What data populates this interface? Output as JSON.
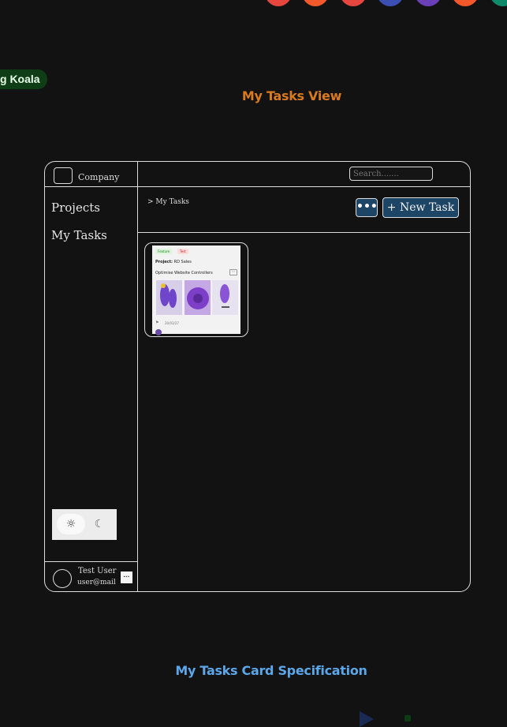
{
  "palette": {
    "colors": [
      "#e5473f",
      "#f2582a",
      "#e5473f",
      "#3b4fb3",
      "#6b3fb8",
      "#f2582a",
      "#0f8a6a"
    ]
  },
  "user_tag": {
    "label": "g Koala"
  },
  "view_title": {
    "text": "My Tasks  View"
  },
  "app": {
    "company": "Company",
    "search_placeholder": "Search.......",
    "nav": {
      "projects": "Projects",
      "my_tasks": "My Tasks"
    },
    "breadcrumb": "> My Tasks",
    "more_label": "•••",
    "new_task_label": "+ New Task",
    "card": {
      "tags": [
        "Feature",
        "Test"
      ],
      "project_label": "Project:",
      "project_name": "RD Sales",
      "title": "Optimise Website Controllers",
      "menu": "···",
      "date": "20/03/27"
    },
    "theme": {
      "light_icon": "☼",
      "dark_icon": "☾"
    },
    "user": {
      "name": "Test User",
      "email": "user@mail",
      "menu": "···"
    }
  },
  "spec_title": {
    "text": "My Tasks Card Specification"
  }
}
